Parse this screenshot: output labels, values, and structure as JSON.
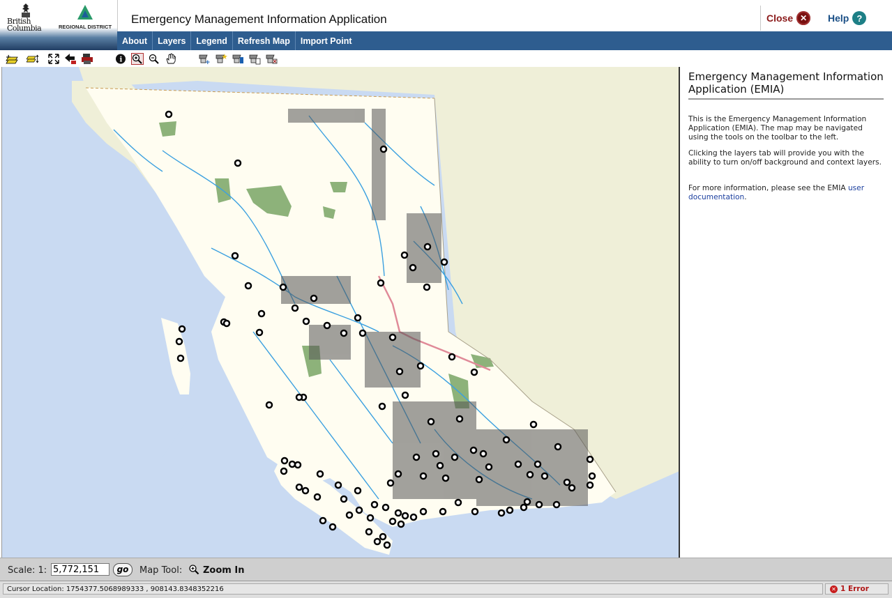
{
  "header": {
    "bc_logo_text": "British Columbia",
    "rd_logo_text": "REGIONAL DISTRICT",
    "title": "Emergency Management Information Application",
    "close_label": "Close",
    "help_label": "Help",
    "close_icon": "close-icon",
    "help_icon": "help-icon"
  },
  "nav": {
    "items": [
      {
        "label": "About"
      },
      {
        "label": "Layers"
      },
      {
        "label": "Legend"
      },
      {
        "label": "Refresh Map"
      },
      {
        "label": "Import Point"
      }
    ]
  },
  "toolbar": {
    "tools": [
      "add-layer-icon",
      "layer-order-icon",
      "full-extent-icon",
      "back-icon",
      "print-icon",
      "identify-icon",
      "zoom-in-icon",
      "zoom-out-icon",
      "pan-icon",
      "query-add-icon",
      "query-star-icon",
      "query-pipe-icon",
      "query-report-icon",
      "query-clear-icon"
    ]
  },
  "info": {
    "title": "Emergency Management Information Application (EMIA)",
    "p1": "This is the Emergency Management Information Application (EMIA). The map may be navigated using the tools on the toolbar to the left.",
    "p2": "Clicking the layers tab will provide you with the ability to turn on/off background and context layers.",
    "p3_prefix": "For more information, please see the EMIA ",
    "p3_link": "user documentation",
    "p3_suffix": "."
  },
  "bottom": {
    "scale_label": "Scale: 1:",
    "scale_value": "5,772,151",
    "go_label": "go",
    "map_tool_label": "Map Tool:",
    "map_tool_value": "Zoom In"
  },
  "status": {
    "cursor_location": "Cursor Location: 1754377.5068989333 , 908143.8348352216",
    "error_label": "1 Error"
  },
  "colors": {
    "nav_bg": "#2e5d8f",
    "ocean": "#c9daf2",
    "land": "#fffdf1",
    "neighbor_land": "#efefd8",
    "park": "#8db27a",
    "river": "#3ba0e0",
    "highway": "#e08a98",
    "close": "#8b1a1a",
    "help": "#1a4f86"
  }
}
